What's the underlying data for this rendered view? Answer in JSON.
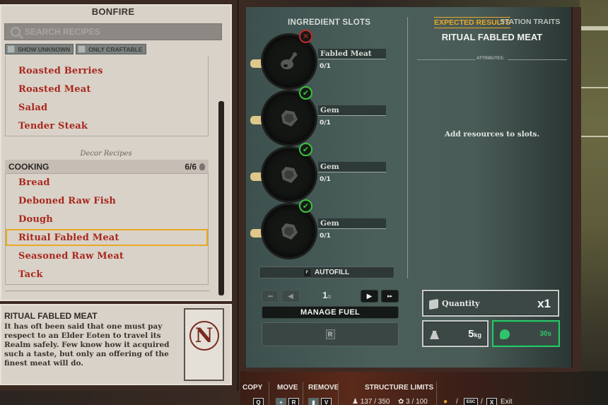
{
  "left_panel": {
    "station_title": "BONFIRE",
    "search_placeholder": "SEARCH RECIPES",
    "filters": [
      {
        "label": "SHOW UNKNOWN",
        "checked": false
      },
      {
        "label": "ONLY CRAFTABLE",
        "checked": false
      }
    ],
    "upper_recipes": [
      "Roasted Berries",
      "Roasted Meat",
      "Salad",
      "Tender Steak"
    ],
    "decor_label": "Decor Recipes",
    "category": {
      "name": "COOKING",
      "count": "6/6"
    },
    "cooking_recipes": [
      "Bread",
      "Deboned Raw Fish",
      "Dough",
      "Ritual Fabled Meat",
      "Seasoned Raw Meat",
      "Tack"
    ],
    "selected_recipe_index": 3,
    "description": {
      "title": "RITUAL FABLED MEAT",
      "text": "It has oft been said that one must pay respect to an Elder Eoten to travel its Realm safely. Few know how it acquired such a taste, but only an offering of the finest meat will do.",
      "card_letter": "N"
    }
  },
  "ingredients": {
    "title": "INGREDIENT SLOTS",
    "slots": [
      {
        "name": "Fabled Meat",
        "amount": "0/1",
        "status": "missing",
        "status_icon": "✕",
        "icon": "meat-icon"
      },
      {
        "name": "Gem",
        "amount": "0/1",
        "status": "ok",
        "status_icon": "✔",
        "icon": "gem-icon"
      },
      {
        "name": "Gem",
        "amount": "0/1",
        "status": "ok",
        "status_icon": "✔",
        "icon": "gem-icon"
      },
      {
        "name": "Gem",
        "amount": "0/1",
        "status": "ok",
        "status_icon": "✔",
        "icon": "gem-icon"
      }
    ],
    "autofill_key": "F",
    "autofill_label": "AUTOFILL",
    "pager": {
      "first": "◂◂",
      "prev": "◀",
      "next": "▶",
      "last": "▸▸",
      "current": "1",
      "total": "/2"
    },
    "manage_fuel_label": "MANAGE FUEL",
    "fuel_key": "R"
  },
  "results": {
    "tabs": [
      {
        "label": "EXPECTED RESULTS",
        "active": true
      },
      {
        "label": "STATION TRAITS",
        "active": false
      }
    ],
    "item_title": "RITUAL FABLED MEAT",
    "attributes_label": "ATTRIBUTES:",
    "empty_message": "Add resources to slots.",
    "quantity_label": "Quantity",
    "quantity_value": "x1",
    "weight_value": "5",
    "weight_unit": "kg",
    "time_value": "30s",
    "accent_color": "#e8a828",
    "time_color": "#2ec46a"
  },
  "hud": {
    "copy_label": "COPY",
    "copy_key": "Q",
    "move_label": "MOVE",
    "move_key": "R",
    "remove_label": "REMOVE",
    "remove_key": "V",
    "structure_limits_label": "STRUCTURE LIMITS",
    "limit_a": "137 / 350",
    "limit_b": "3 / 100",
    "esc_key": "ESC",
    "exit_key": "X",
    "exit_label": "Exit"
  }
}
